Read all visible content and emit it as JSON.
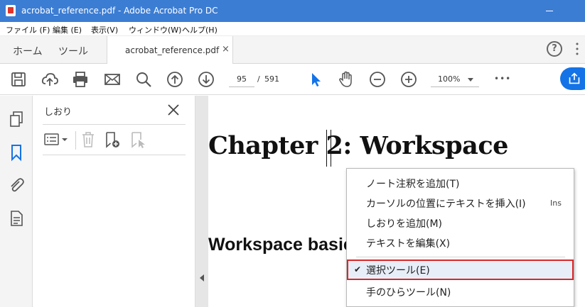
{
  "window": {
    "title": "acrobat_reference.pdf - Adobe Acrobat Pro DC"
  },
  "menubar": {
    "items": [
      "ファイル (F)",
      "編集 (E)",
      "表示(V)",
      "ウィンドウ(W)",
      "ヘルプ(H)"
    ]
  },
  "tabs": {
    "home": "ホーム",
    "tools": "ツール",
    "document": "acrobat_reference.pdf",
    "close_glyph": "×",
    "help_glyph": "?"
  },
  "toolbar": {
    "page_current": "95",
    "page_separator": "/",
    "page_total": "591",
    "zoom": "100%",
    "more_glyph": "•••"
  },
  "bookmarks_panel": {
    "title": "しおり"
  },
  "document": {
    "heading": "Chapter 2: Workspace",
    "subheading": "Workspace basic"
  },
  "context_menu": {
    "items": [
      {
        "label": "ノート注釈を追加(T)",
        "shortcut": ""
      },
      {
        "label": "カーソルの位置にテキストを挿入(I)",
        "shortcut": "Ins"
      },
      {
        "label": "しおりを追加(M)",
        "shortcut": ""
      },
      {
        "label": "テキストを編集(X)",
        "shortcut": ""
      },
      {
        "label": "選択ツール(E)",
        "shortcut": "",
        "checked": true,
        "check_glyph": "✔"
      },
      {
        "label": "手のひらツール(N)",
        "shortcut": ""
      }
    ]
  },
  "colors": {
    "titlebar": "#3c7dd4",
    "accent": "#1473e6",
    "highlight_border": "#d6282a"
  }
}
